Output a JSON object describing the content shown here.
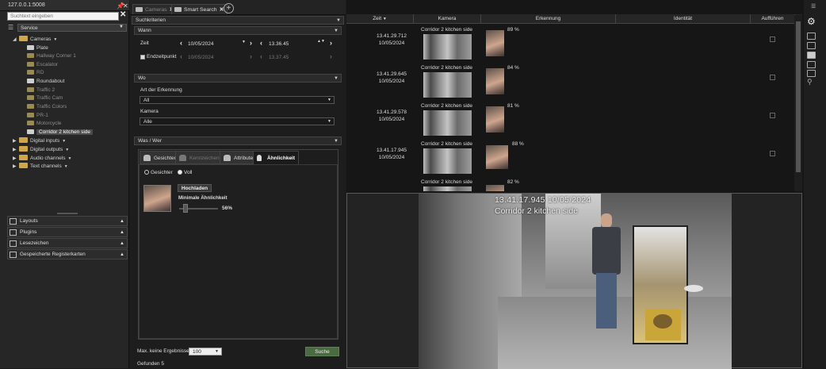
{
  "server": {
    "address": "127.0.0.1:5008"
  },
  "left": {
    "search_placeholder": "Suchtext eingeben",
    "server_select": "Service",
    "tree": [
      {
        "label": "Cameras",
        "type": "folder"
      },
      {
        "label": "Plate",
        "type": "camera",
        "active": true
      },
      {
        "label": "Hallway Corner 1",
        "type": "camera",
        "active": false
      },
      {
        "label": "Escalator",
        "type": "camera",
        "active": false
      },
      {
        "label": "RD",
        "type": "camera",
        "active": false
      },
      {
        "label": "Roundabout",
        "type": "camera",
        "active": true
      },
      {
        "label": "Traffic 2",
        "type": "camera",
        "active": false
      },
      {
        "label": "Traffic Cam",
        "type": "camera",
        "active": false
      },
      {
        "label": "Traffic Colors",
        "type": "camera",
        "active": false
      },
      {
        "label": "PR-1",
        "type": "camera",
        "active": false
      },
      {
        "label": "Motorcycle",
        "type": "camera",
        "active": false
      },
      {
        "label": "Corridor 2 kitchen side",
        "type": "camera",
        "active": true
      },
      {
        "label": "Digital inputs",
        "type": "folder"
      },
      {
        "label": "Digital outputs",
        "type": "folder"
      },
      {
        "label": "Audio channels",
        "type": "folder"
      },
      {
        "label": "Text channels",
        "type": "folder"
      }
    ],
    "accordions": [
      "Layouts",
      "Plugins",
      "Lesezeichen",
      "Gespeicherte Registerkarten"
    ]
  },
  "tabs": [
    {
      "label": "Cameras"
    },
    {
      "label": "Smart Search"
    }
  ],
  "search": {
    "criteria_label": "Suchkriterien",
    "when_label": "Wann",
    "time_label": "Zeit",
    "date_value": "10/05/2024",
    "time_value": "13.36.45",
    "endpoint_label": "Endzeitpunkt",
    "end_date_value": "10/05/2024",
    "end_time_value": "13.37.45",
    "where_label": "Wo",
    "detection_type_label": "Art der Erkennung",
    "detection_type_value": "All",
    "camera_label": "Kamera",
    "camera_value": "Alle",
    "who_label": "Was / Wer",
    "filter_tabs": [
      {
        "label": "Gesichter"
      },
      {
        "label": "Kennzeichen"
      },
      {
        "label": "Attribute"
      },
      {
        "label": "Ähnlichkeit"
      }
    ],
    "radio_faces": "Gesichter",
    "radio_body": "Voll",
    "upload_label": "Hochladen",
    "min_similarity_label": "Minimale Ähnlichkeit",
    "min_similarity_value": "56%",
    "min_similarity_fraction": 0.56,
    "max_results_label": "Max. keine Ergebnisse",
    "max_results_value": "100",
    "search_button": "Suche",
    "found_label": "Gefunden 5"
  },
  "results": {
    "columns": [
      "Zeit",
      "Kamera",
      "Erkennung",
      "Identität",
      "Aufführen"
    ],
    "rows": [
      {
        "time": "13.41.29.712",
        "date": "10/05/2024",
        "camera": "Corridor 2 kitchen side",
        "score": "89 %"
      },
      {
        "time": "13.41.29.645",
        "date": "10/05/2024",
        "camera": "Corridor 2 kitchen side",
        "score": "84 %"
      },
      {
        "time": "13.41.29.578",
        "date": "10/05/2024",
        "camera": "Corridor 2 kitchen side",
        "score": "81 %"
      },
      {
        "time": "13.41.17.945",
        "date": "10/05/2024",
        "camera": "Corridor 2 kitchen side",
        "score": "88 %"
      },
      {
        "time": "",
        "date": "",
        "camera": "Corridor 2 kitchen side",
        "score": "82 %"
      }
    ]
  },
  "video": {
    "osd_time": "13.41.17.945 10/05/2024",
    "osd_camera": "Corridor 2 kitchen side"
  },
  "colors": {
    "accent_green": "#4a6b3f",
    "video_border": "#2a7a2a",
    "folder": "#cfa64a"
  }
}
